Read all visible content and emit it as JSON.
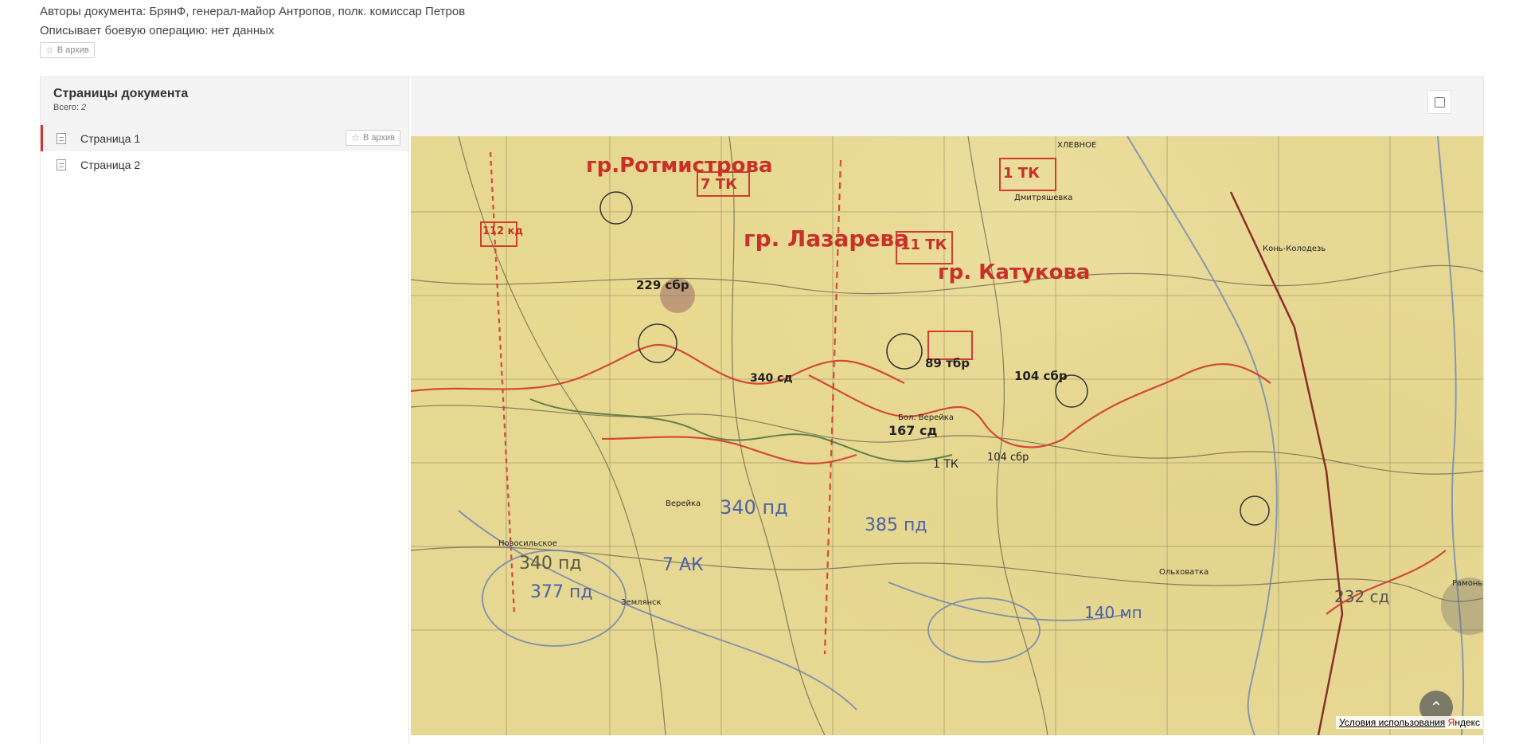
{
  "document": {
    "authors": "Авторы документа: БрянФ, генерал-майор Антропов, полк. комиссар Петров",
    "operation": "Описывает боевую операцию: нет данных",
    "archive_label": "В архив"
  },
  "sidebar": {
    "title": "Страницы документа",
    "count_label": "Всего:",
    "count_value": "2",
    "items": [
      {
        "label": "Страница 1",
        "archive_label": "В архив",
        "active": true
      },
      {
        "label": "Страница 2",
        "active": false
      }
    ]
  },
  "map": {
    "labels_red": [
      "гр.Ротмистрова",
      "7 ТК",
      "гр. Лазарева",
      "11 ТК",
      "гр. Катукова",
      "1 ТК",
      "112 кд",
      "229 сбр",
      "167 сд",
      "104 сбр",
      "89 тбр",
      "340 сд",
      "1 ТК",
      "104 сбр"
    ],
    "labels_blue": [
      "340 пд",
      "385 пд",
      "377 пд",
      "340 пд",
      "140 мп",
      "7 АК",
      "232 сд"
    ],
    "labels_black": [
      "ХЛЕВНОЕ",
      "Дмитряшевка",
      "Конь-Колодезь",
      "Землянск",
      "Ольховатка",
      "Верейка",
      "Новосильское",
      "Бол. Верейка",
      "Рамонь"
    ]
  },
  "footer": {
    "terms_link": "Условия использования",
    "brand_y": "Я",
    "brand_rest": "ндекс"
  },
  "icons": {
    "star": "star-icon",
    "document": "document-icon",
    "expand": "expand-icon",
    "chevron_up": "chevron-up-icon"
  }
}
